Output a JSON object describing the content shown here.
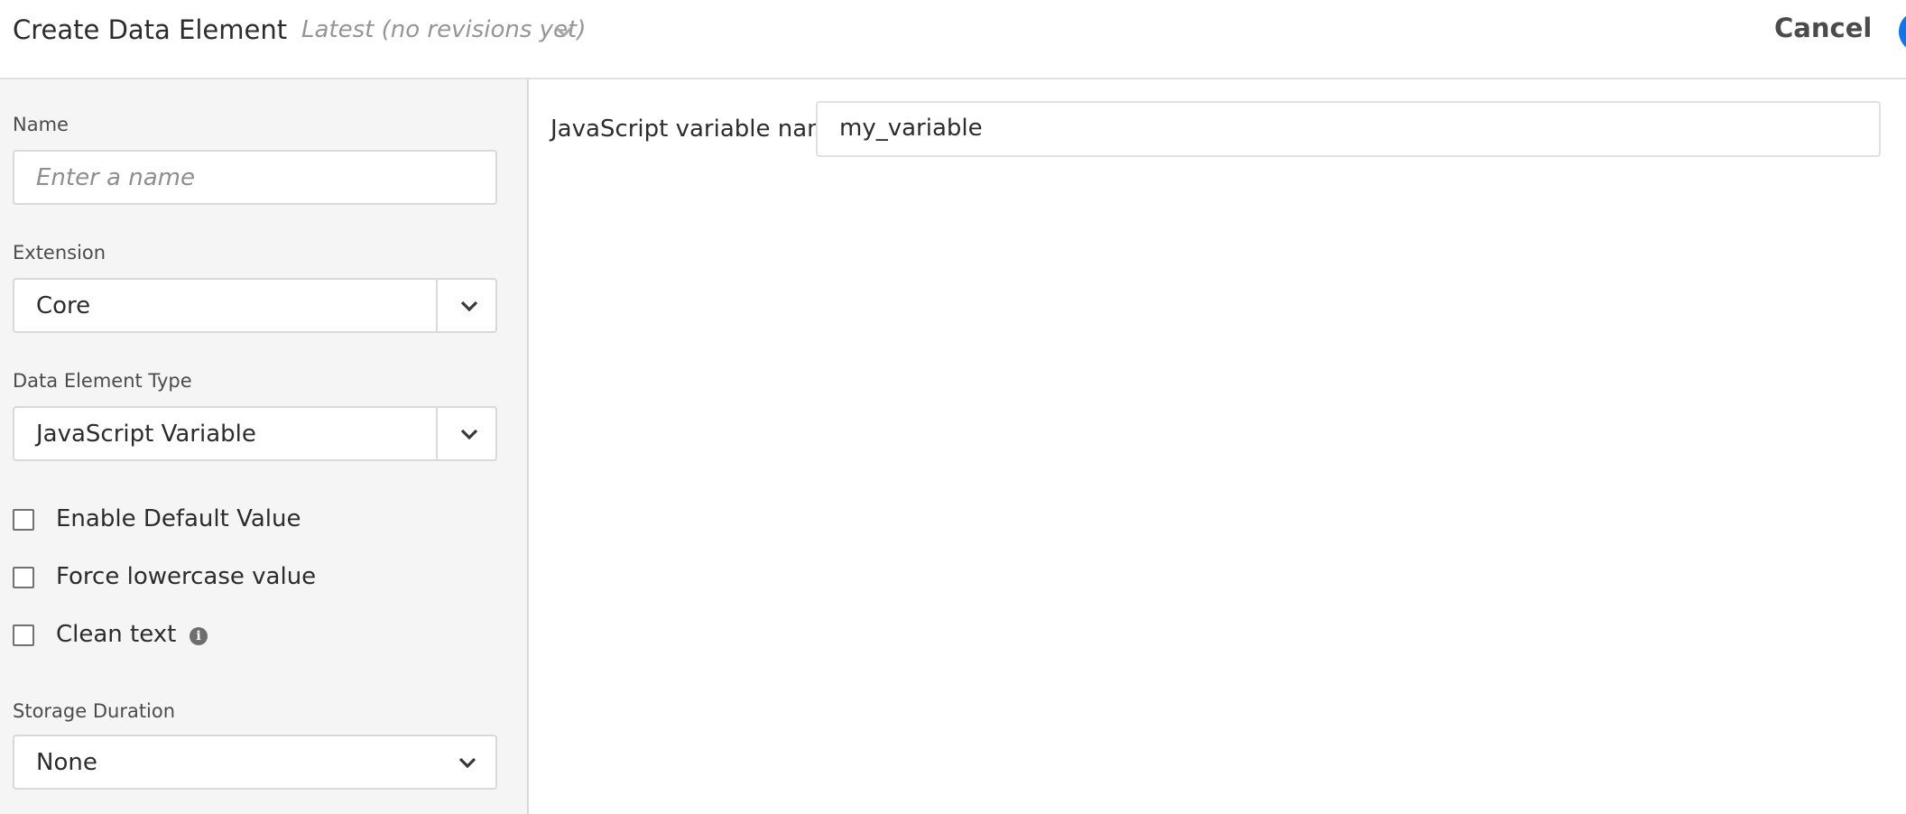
{
  "header": {
    "title": "Create Data Element",
    "revision": "Latest (no revisions yet)",
    "cancel_label": "Cancel",
    "revision_icon": "chevron-down-icon",
    "save_color": "#1473e6"
  },
  "sidebar": {
    "name": {
      "label": "Name",
      "placeholder": "Enter a name",
      "value": ""
    },
    "extension": {
      "label": "Extension",
      "value": "Core",
      "icon": "chevron-down-icon"
    },
    "data_element_type": {
      "label": "Data Element Type",
      "value": "JavaScript Variable",
      "icon": "chevron-down-icon"
    },
    "checkboxes": [
      {
        "label": "Enable Default Value",
        "checked": false
      },
      {
        "label": "Force lowercase value",
        "checked": false
      },
      {
        "label": "Clean text",
        "checked": false,
        "info_icon": "info-icon"
      }
    ],
    "storage_duration": {
      "label": "Storage Duration",
      "value": "None",
      "icon": "chevron-down-icon"
    }
  },
  "main": {
    "variable_label": "JavaScript variable name",
    "variable_value": "my_variable"
  }
}
